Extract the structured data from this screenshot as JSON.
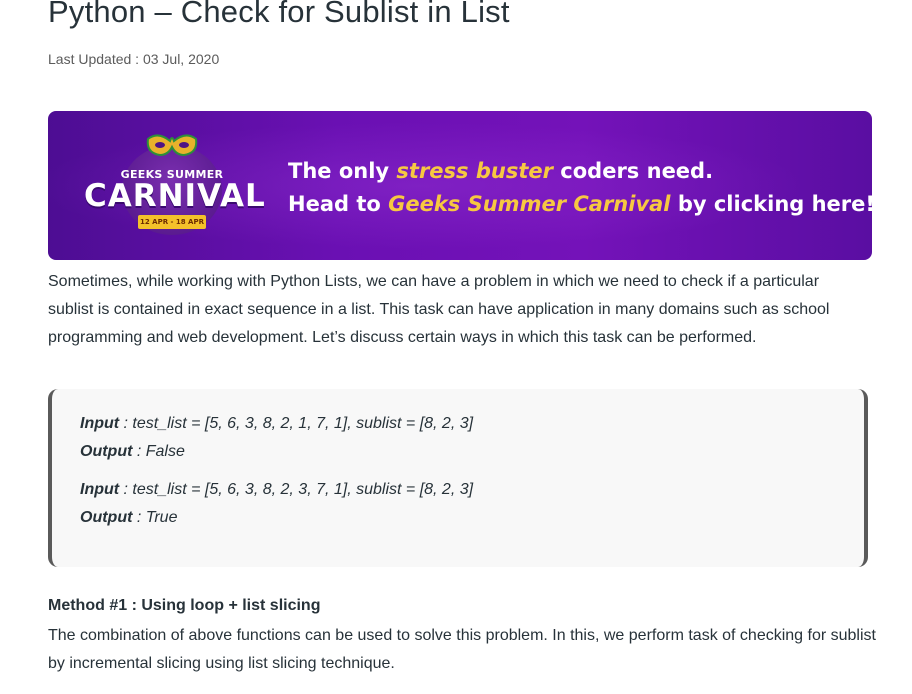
{
  "article": {
    "title": "Python – Check for Sublist in List",
    "last_updated": "Last Updated : 03 Jul, 2020"
  },
  "banner": {
    "logo_small_text": "GEEKS SUMMER",
    "logo_big_text": "CARNIVAL",
    "logo_dates": "12 APR - 18 APR",
    "line1_prefix": "The only ",
    "line1_highlight": "stress buster",
    "line1_suffix": " coders need.",
    "line2_prefix": "Head to ",
    "line2_highlight": "Geeks Summer Carnival",
    "line2_suffix": " by clicking here!",
    "colors": {
      "background": "#6a10b3",
      "highlight": "#f7c841",
      "ribbon": "#f4c12a"
    }
  },
  "intro": "Sometimes, while working with Python Lists, we can have a problem in which we need to check if a particular sublist is contained in exact sequence in a list. This task can have application in many domains such as school programming and web development. Let’s discuss certain ways in which this task can be performed.",
  "examples": [
    {
      "input_label": "Input",
      "input_text": " : test_list = [5, 6, 3, 8, 2, 1, 7, 1], sublist = [8, 2, 3]",
      "output_label": "Output",
      "output_text": " : False"
    },
    {
      "input_label": "Input",
      "input_text": " : test_list = [5, 6, 3, 8, 2, 3, 7, 1], sublist = [8, 2, 3]",
      "output_label": "Output",
      "output_text": " : True"
    }
  ],
  "method": {
    "title": "Method #1 : Using loop + list slicing",
    "description": "The combination of above functions can be used to solve this problem. In this, we perform task of checking for sublist by incremental slicing using list slicing technique."
  }
}
